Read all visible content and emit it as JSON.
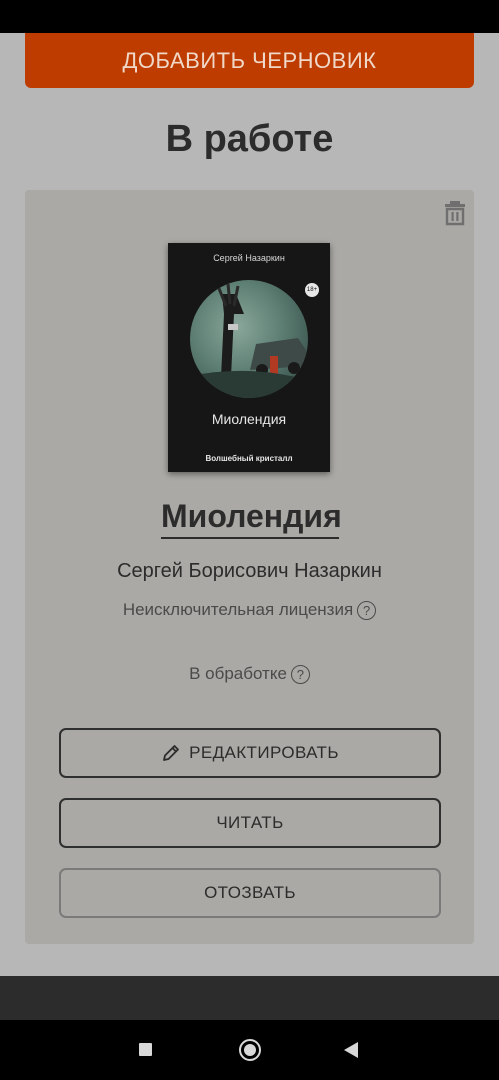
{
  "draft_button": {
    "label": "ДОБАВИТЬ ЧЕРНОВИК"
  },
  "section": {
    "title": "В работе"
  },
  "book": {
    "cover": {
      "author": "Сергей Назаркин",
      "age_badge": "18+",
      "title": "Миолендия",
      "subtitle": "Волшебный кристалл"
    },
    "title": "Миолендия",
    "author": "Сергей Борисович Назаркин",
    "license": "Неисключительная лицензия",
    "status": "В обработке",
    "help_mark": "?"
  },
  "actions": {
    "edit_label": "РЕДАКТИРОВАТЬ",
    "read_label": "ЧИТАТЬ",
    "revoke_label": "ОТОЗВАТЬ"
  },
  "icons": {
    "trash": "trash-icon",
    "pencil": "pencil-icon",
    "help": "help-icon"
  },
  "colors": {
    "accent": "#bf3c00",
    "background": "#b7b7b7",
    "card": "#aaa9a5"
  }
}
